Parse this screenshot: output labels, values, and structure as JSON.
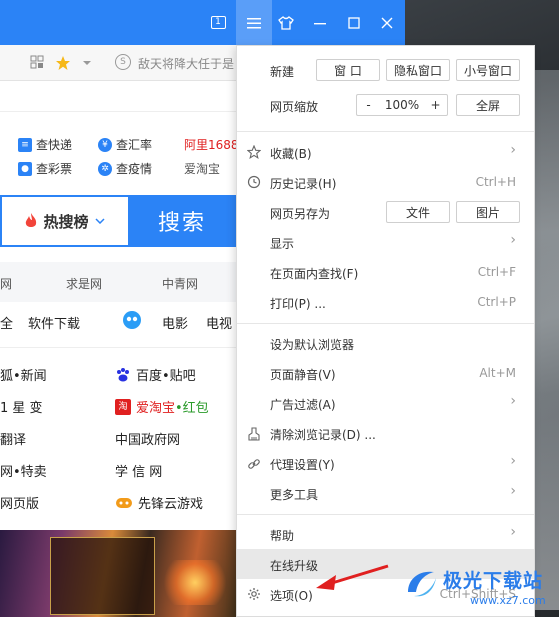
{
  "titlebar": {
    "tab_count": "1",
    "buttons": [
      "tab-count",
      "menu",
      "skin",
      "minimize",
      "maximize",
      "close"
    ]
  },
  "addressbar": {
    "text": "敌天将降大任于是"
  },
  "quicklinks": {
    "row1": [
      "查快递",
      "查汇率",
      "阿里1688"
    ],
    "row2": [
      "查彩票",
      "查疫情",
      "爱淘宝"
    ]
  },
  "search": {
    "hot_label": "热搜榜",
    "button_label": "搜索"
  },
  "news_sites": [
    "网",
    "求是网",
    "中青网"
  ],
  "categories": [
    "全",
    "软件下载",
    "电影",
    "电视"
  ],
  "sites": {
    "r1": [
      "狐•新闻",
      "百度•贴吧"
    ],
    "r2": [
      "1 星 变",
      "爱淘宝",
      "•红包"
    ],
    "r3": [
      "翻译",
      "中国政府网"
    ],
    "r4": [
      "网•特卖",
      "学 信 网"
    ],
    "r5": [
      "网页版",
      "先锋云游戏"
    ]
  },
  "menu": {
    "new_label": "新建",
    "new_window": "窗 口",
    "private_window": "隐私窗口",
    "small_window": "小号窗口",
    "zoom_label": "网页缩放",
    "zoom_minus": "-",
    "zoom_value": "100%",
    "zoom_plus": "+",
    "fullscreen": "全屏",
    "favorites": "收藏(B)",
    "history": "历史记录(H)",
    "history_shortcut": "Ctrl+H",
    "save_as": "网页另存为",
    "save_file": "文件",
    "save_image": "图片",
    "display": "显示",
    "find": "在页面内查找(F)",
    "find_shortcut": "Ctrl+F",
    "print": "打印(P) ...",
    "print_shortcut": "Ctrl+P",
    "default_browser": "设为默认浏览器",
    "mute": "页面静音(V)",
    "mute_shortcut": "Alt+M",
    "adblock": "广告过滤(A)",
    "clear": "清除浏览记录(D) ...",
    "proxy": "代理设置(Y)",
    "more_tools": "更多工具",
    "help": "帮助",
    "upgrade": "在线升级",
    "options": "选项(O)",
    "options_shortcut": "Ctrl+Shift+S"
  },
  "watermark": {
    "name": "极光下载站",
    "url": "www.xz7.com"
  },
  "colors": {
    "accent": "#2b83f6",
    "annotation": "#e02020"
  }
}
